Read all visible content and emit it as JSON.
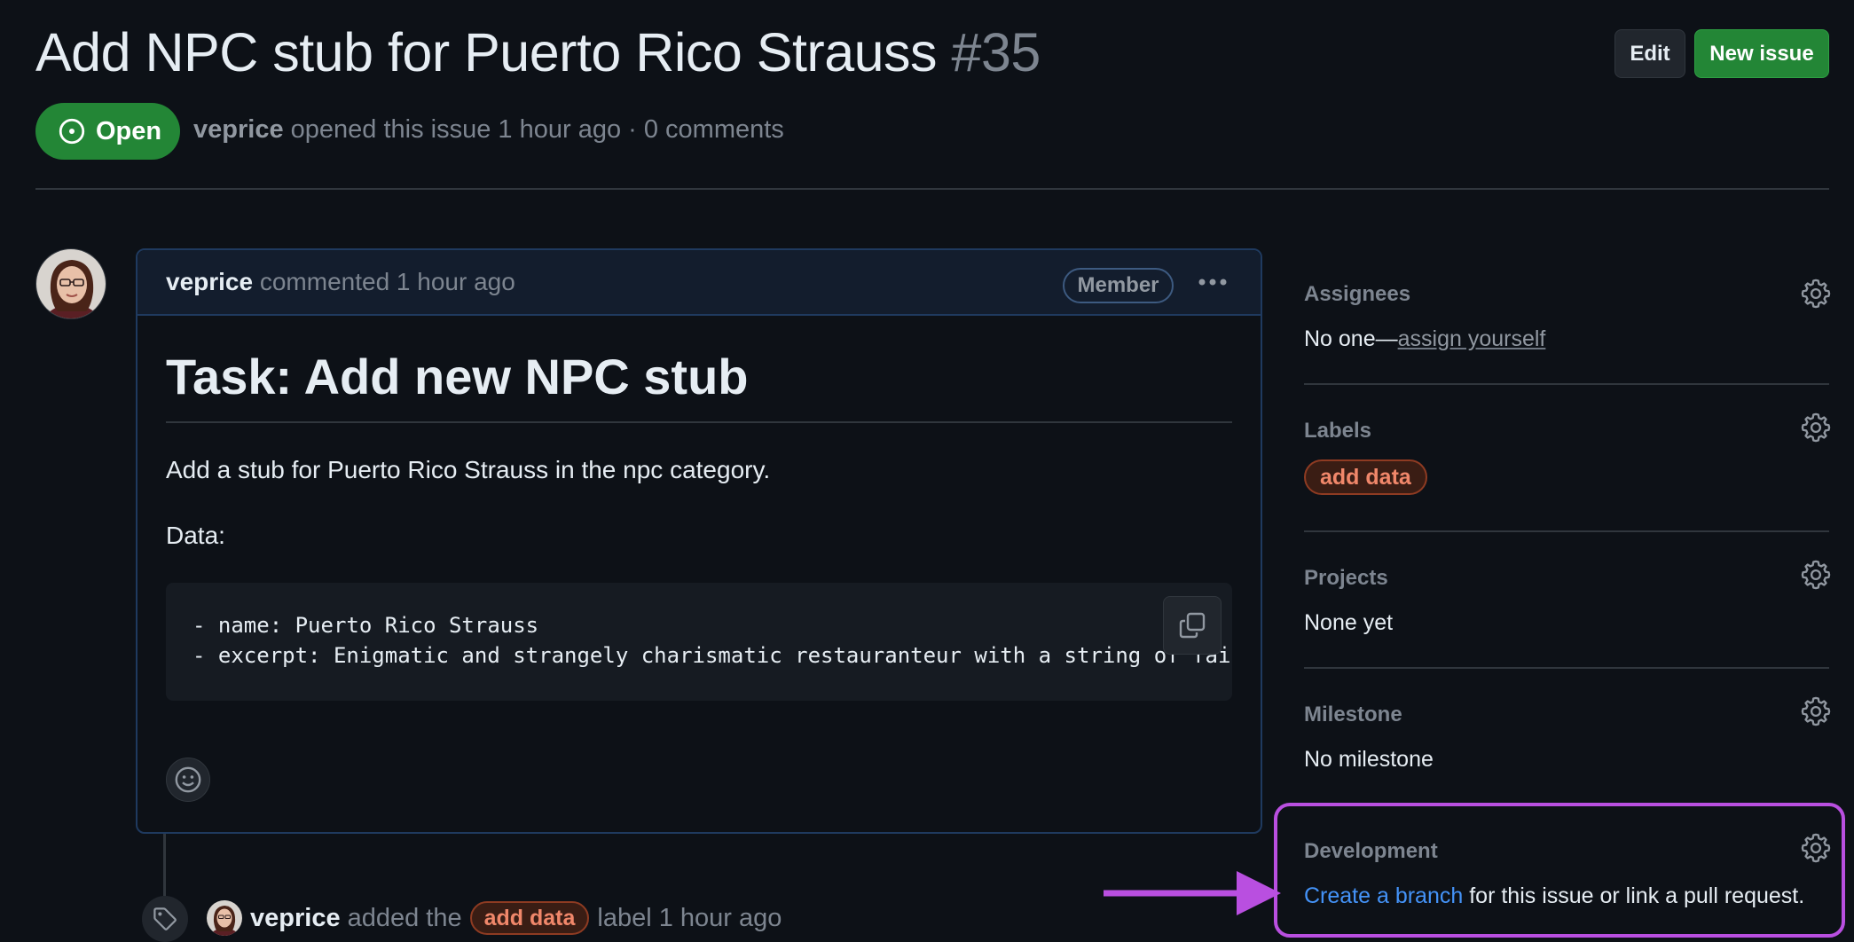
{
  "header": {
    "title": "Add NPC stub for Puerto Rico Strauss",
    "number": "#35",
    "edit_label": "Edit",
    "new_issue_label": "New issue",
    "state": "Open",
    "author": "veprice",
    "meta_text": "opened this issue 1 hour ago · 0 comments"
  },
  "comment": {
    "author": "veprice",
    "action": "commented 1 hour ago",
    "role_badge": "Member",
    "more_label": "···",
    "heading": "Task: Add new NPC stub",
    "paragraph": "Add a stub for Puerto Rico Strauss in the npc category.",
    "data_label": "Data:",
    "code_lines": [
      "- name: Puerto Rico Strauss",
      "- excerpt: Enigmatic and strangely charismatic restauranteur with a string of fail"
    ]
  },
  "timeline": {
    "author": "veprice",
    "before": "added the",
    "label": "add data",
    "after": "label 1 hour ago"
  },
  "sidebar": {
    "assignees": {
      "title": "Assignees",
      "value": "No one—",
      "link": "assign yourself"
    },
    "labels": {
      "title": "Labels",
      "label": "add data"
    },
    "projects": {
      "title": "Projects",
      "value": "None yet"
    },
    "milestone": {
      "title": "Milestone",
      "value": "No milestone"
    },
    "development": {
      "title": "Development",
      "link": "Create a branch",
      "rest": " for this issue or link a pull request."
    }
  },
  "colors": {
    "background": "#0d1117",
    "open_green": "#238636",
    "link_blue": "#4493f8",
    "label_orange": "#f0876a",
    "highlight_purple": "#b94fe0"
  }
}
